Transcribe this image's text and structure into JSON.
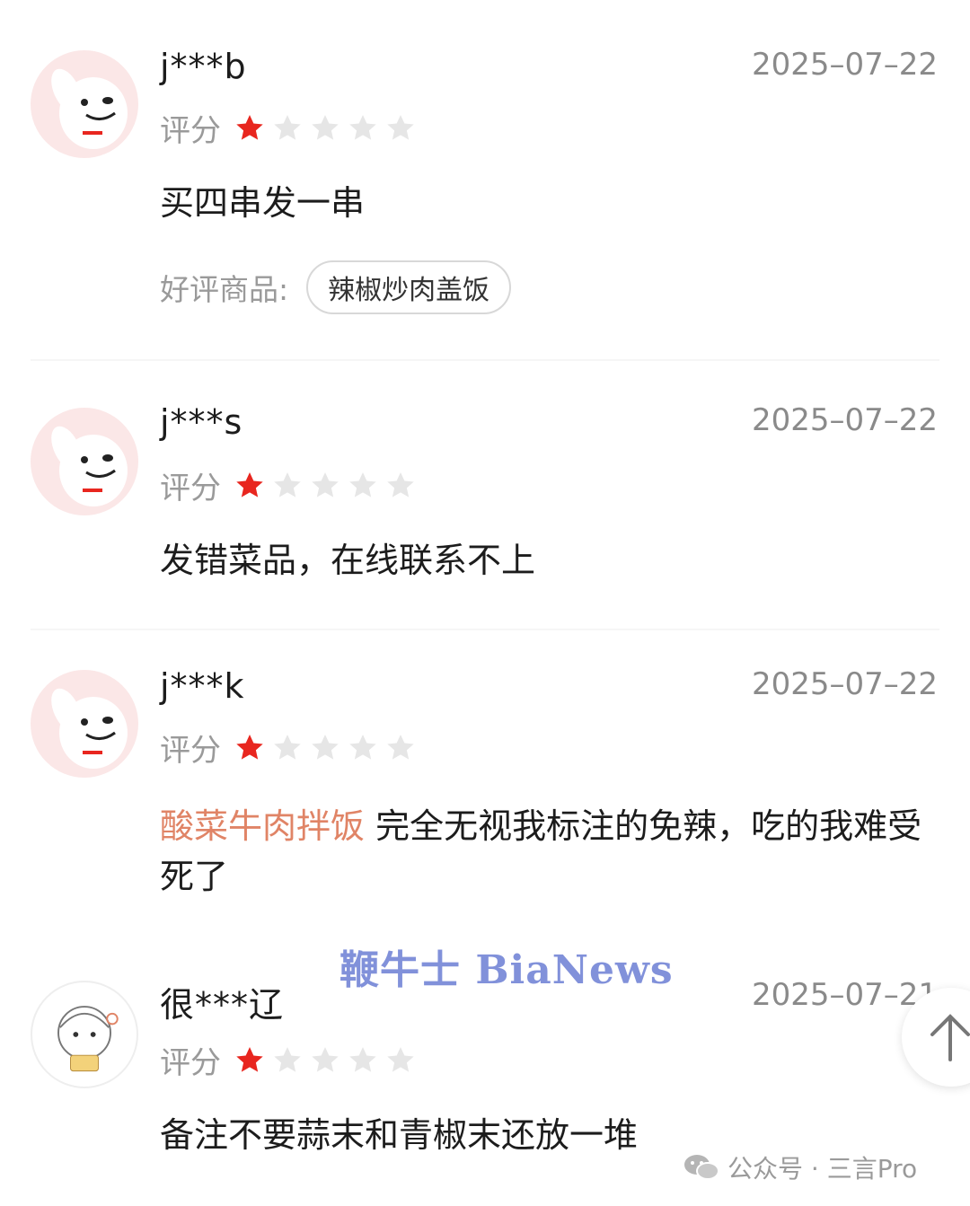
{
  "rating_label": "评分",
  "reviews": [
    {
      "username": "j***b",
      "date": "2025–07–22",
      "stars_filled": 1,
      "stars_total": 5,
      "content": "买四串发一串",
      "tag_label": "好评商品:",
      "tag": "辣椒炒肉盖饭"
    },
    {
      "username": "j***s",
      "date": "2025–07–22",
      "stars_filled": 1,
      "stars_total": 5,
      "content": "发错菜品，在线联系不上"
    },
    {
      "username": "j***k",
      "date": "2025–07–22",
      "stars_filled": 1,
      "stars_total": 5,
      "content_highlight": "酸菜牛肉拌饭",
      "content": " 完全无视我标注的免辣，吃的我难受死了"
    },
    {
      "username": "很***辽",
      "date": "2025–07–21",
      "stars_filled": 1,
      "stars_total": 5,
      "content": "备注不要蒜末和青椒末还放一堆"
    }
  ],
  "watermark": "鞭牛士 BiaNews",
  "footer": {
    "text": "公众号 · 三言Pro",
    "icon": "wechat-icon"
  },
  "colors": {
    "star_filled": "#e8261f",
    "star_empty": "#e6e6e6",
    "highlight": "#e08466",
    "avatar_bg": "#fbe7e7"
  },
  "icons": {
    "back_to_top": "arrow-up-icon",
    "avatar_default": "dog-mascot-avatar",
    "avatar_alt": "anime-girl-avatar"
  }
}
